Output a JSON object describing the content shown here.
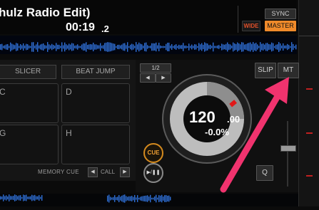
{
  "deck": {
    "track_title": "hulz Radio Edit)",
    "elapsed_main": "00:19",
    "elapsed_frac": ".2",
    "sync_label": "SYNC",
    "wide_label": "WIDE",
    "master_label": "MASTER"
  },
  "pad_panel": {
    "tabs": [
      "SLICER",
      "BEAT JUMP"
    ],
    "pads": [
      "C",
      "D",
      "G",
      "H"
    ],
    "memory_cue_label": "MEMORY CUE",
    "call_label": "CALL"
  },
  "jog": {
    "beat_fraction": "1/2",
    "slip_label": "SLIP",
    "mt_label": "MT",
    "q_label": "Q",
    "cue_label": "CUE",
    "play_pause_glyph": "▶/❚❚",
    "bpm_integer": "120",
    "bpm_decimal": ".00",
    "pitch": "-0.0%"
  },
  "colors": {
    "accent": "#ef8a2a",
    "waveform": "#2f6fd6",
    "annotation_arrow": "#f0336e",
    "jog_marker": "#e01818"
  },
  "icons": {
    "nudge_left": "◀",
    "nudge_right": "▶",
    "call_prev": "◀",
    "call_next": "▶"
  }
}
